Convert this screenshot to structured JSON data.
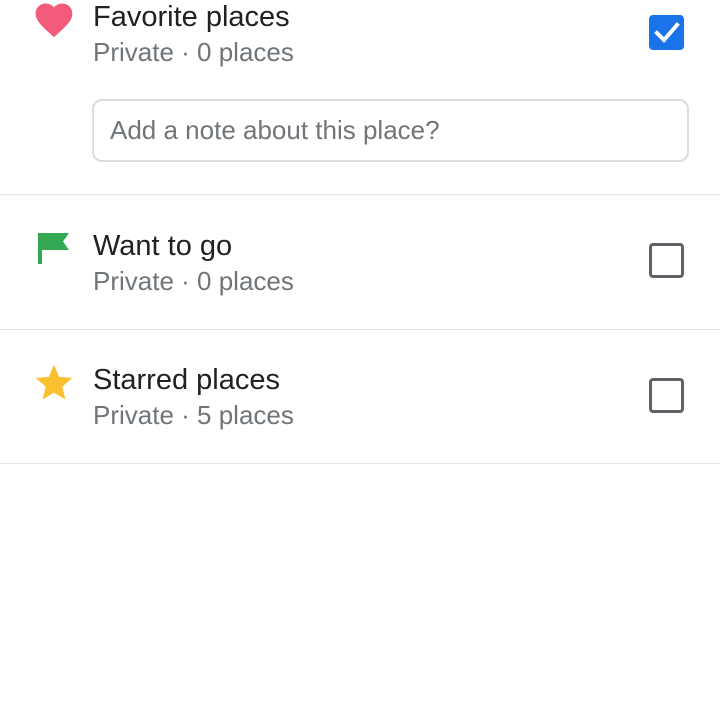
{
  "lists": [
    {
      "title": "Favorite places",
      "subtitle": "Private · 0 places",
      "icon": "heart-icon",
      "icon_color": "#f25c7a",
      "checked": true,
      "note_placeholder": "Add a note about this place?"
    },
    {
      "title": "Want to go",
      "subtitle": "Private · 0 places",
      "icon": "flag-icon",
      "icon_color": "#34a853",
      "checked": false
    },
    {
      "title": "Starred places",
      "subtitle": "Private · 5 places",
      "icon": "star-icon",
      "icon_color": "#fbc02d",
      "checked": false
    }
  ],
  "colors": {
    "checkbox_checked": "#1a73e8",
    "checkbox_unchecked_border": "#5f6368",
    "divider": "#e3e3e3"
  }
}
